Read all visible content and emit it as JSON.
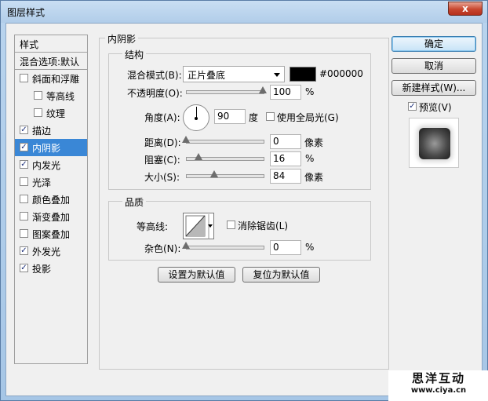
{
  "window": {
    "title": "图层样式",
    "close": "x"
  },
  "styles_list": {
    "header": "样式",
    "blending_options": "混合选项:默认",
    "items": [
      {
        "label": "斜面和浮雕",
        "checked": false,
        "sub": false
      },
      {
        "label": "等高线",
        "checked": false,
        "sub": true
      },
      {
        "label": "纹理",
        "checked": false,
        "sub": true
      },
      {
        "label": "描边",
        "checked": true,
        "sub": false
      },
      {
        "label": "内阴影",
        "checked": true,
        "sub": false,
        "selected": true
      },
      {
        "label": "内发光",
        "checked": true,
        "sub": false
      },
      {
        "label": "光泽",
        "checked": false,
        "sub": false
      },
      {
        "label": "颜色叠加",
        "checked": false,
        "sub": false
      },
      {
        "label": "渐变叠加",
        "checked": false,
        "sub": false
      },
      {
        "label": "图案叠加",
        "checked": false,
        "sub": false
      },
      {
        "label": "外发光",
        "checked": true,
        "sub": false
      },
      {
        "label": "投影",
        "checked": true,
        "sub": false
      }
    ]
  },
  "inner_shadow": {
    "title": "内阴影",
    "structure": {
      "title": "结构",
      "blend_mode_label": "混合模式(B):",
      "blend_mode_value": "正片叠底",
      "color_hex": "#000000",
      "opacity_label": "不透明度(O):",
      "opacity_value": "100",
      "opacity_unit": "%",
      "angle_label": "角度(A):",
      "angle_value": "90",
      "angle_unit": "度",
      "global_light_label": "使用全局光(G)",
      "global_light_checked": false,
      "distance_label": "距离(D):",
      "distance_value": "0",
      "distance_unit": "像素",
      "choke_label": "阻塞(C):",
      "choke_value": "16",
      "choke_unit": "%",
      "size_label": "大小(S):",
      "size_value": "84",
      "size_unit": "像素"
    },
    "quality": {
      "title": "品质",
      "contour_label": "等高线:",
      "anti_alias_label": "消除锯齿(L)",
      "anti_alias_checked": false,
      "noise_label": "杂色(N):",
      "noise_value": "0",
      "noise_unit": "%"
    },
    "buttons": {
      "set_default": "设置为默认值",
      "reset_default": "复位为默认值"
    }
  },
  "right_panel": {
    "ok": "确定",
    "cancel": "取消",
    "new_style": "新建样式(W)...",
    "preview_label": "预览(V)",
    "preview_checked": true
  },
  "watermark": {
    "name": "思洋互动",
    "url": "www.ciya.cn"
  },
  "colors": {
    "selection": "#3a87d6",
    "shadow_color": "#000000"
  }
}
